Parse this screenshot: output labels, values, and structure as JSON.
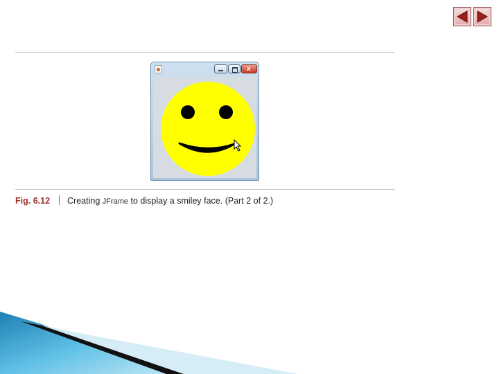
{
  "nav": {
    "prev_icon": "left-arrow-icon",
    "next_icon": "right-arrow-icon"
  },
  "window": {
    "title_icon": "java-app-icon",
    "controls": [
      "minimize-icon",
      "maximize-icon",
      "close-icon"
    ],
    "close_glyph": "x",
    "face_color": "#ffff00",
    "feature_color": "#000000",
    "background": "#d7dce3"
  },
  "caption": {
    "label": "Fig. 6.12",
    "text_before": "Creating ",
    "code": "JFrame",
    "text_after": " to display a smiley face. (Part 2 of 2.)"
  },
  "colors": {
    "nav_button": "#e4a8a8",
    "caption_label": "#a0312b",
    "decor_blue": "#3a9fd0"
  }
}
